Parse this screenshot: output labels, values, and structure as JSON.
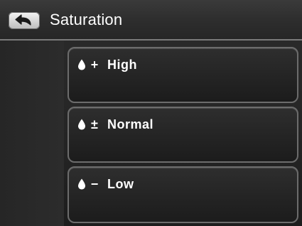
{
  "header": {
    "title": "Saturation",
    "back_icon": "back-arrow-icon"
  },
  "options": [
    {
      "icon": "droplet-icon",
      "sign": "+",
      "label": "High"
    },
    {
      "icon": "droplet-icon",
      "sign": "±",
      "label": "Normal"
    },
    {
      "icon": "droplet-icon",
      "sign": "−",
      "label": "Low"
    }
  ],
  "colors": {
    "background": "#262626",
    "header": "#2e2e2e",
    "border": "#6c6c6c",
    "text": "#ffffff",
    "back_button": "#d8d8d8"
  }
}
